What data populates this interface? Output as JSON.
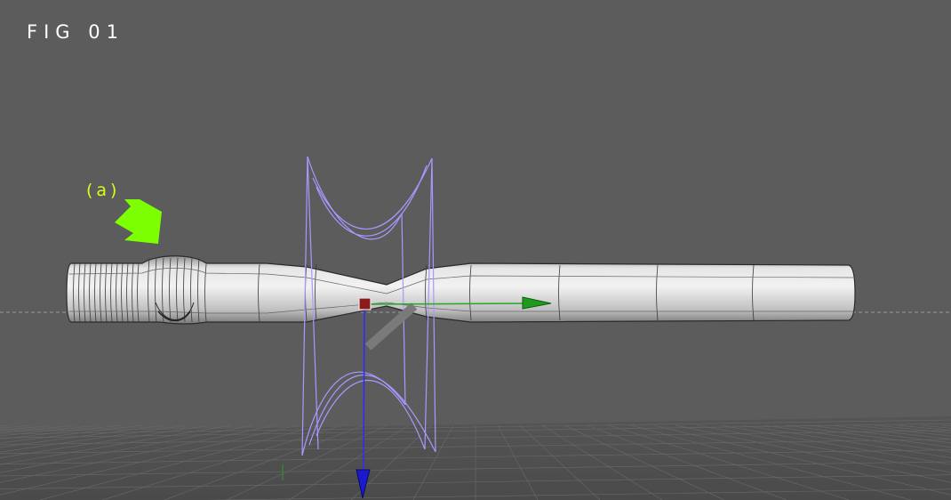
{
  "figure": {
    "label": "FIG 01"
  },
  "annotation": {
    "label": "(a)",
    "arrow_color": "#7cff00",
    "label_color": "#d6ff1a"
  },
  "viewport": {
    "background": "#5c5c5c",
    "ground_grid": true,
    "horizon_line": "dashed"
  },
  "scene": {
    "object": "tube-mesh",
    "deformer": "hourglass-lattice",
    "mesh_color": "#d9d9d9",
    "lattice_color": "#9a8cff",
    "gizmo": {
      "x_axis_color": "#22aa22",
      "y_axis_color": "#1a1acc",
      "pivot_color": "#8b1a1a"
    }
  }
}
